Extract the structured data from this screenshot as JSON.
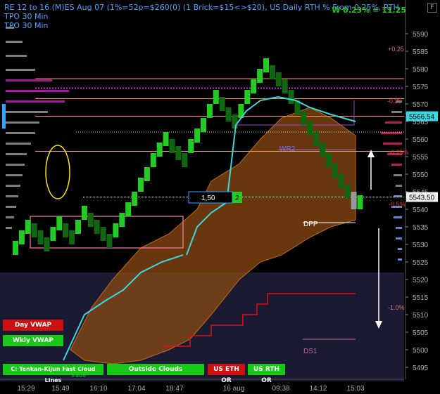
{
  "header": {
    "line1": "RE 12 to 16 (M)ES Aug 07 (1%=52p=$260(0) (1 Brick=$15<>$20), US Daily RTH % From 0.25%, RTH TPO 30 Min",
    "line2": "TPO 30 Min",
    "right_text": "W 0.23% = 11.25",
    "corner_icon": "F"
  },
  "buttons": {
    "day_vwap": "Day VWAP",
    "wkly_vwap": "Wkly VWAP",
    "cloud": "C: Tenkan-Kijun Fast Cloud Lines",
    "outside": "Outside Clouds",
    "us_eth": "US ETH OR",
    "us_rth": "US RTH OR"
  },
  "footer_note": "Trade",
  "price_tags": {
    "current_upper": "5566.54",
    "current_lower": "5543.50",
    "ratio_value": "1,50",
    "ratio_count": "2"
  },
  "levels": {
    "pct_up": "+0.25",
    "pct_minus": "-0.25",
    "pct_minus2": "-0.25%",
    "pct_down": "-0.5%",
    "pct_down_big": "-1.0%",
    "wr2": "WR2",
    "dpp": "DPP",
    "ds1": "DS1"
  },
  "colors": {
    "up_brick": "#22cc22",
    "down_brick": "#116611",
    "cloud": "#8b4a12",
    "cyan_line": "#39d8e0",
    "orange_line": "#ff9a2e",
    "magenta_line": "#d21bd2",
    "red_step": "#e01010"
  },
  "chart_data": {
    "type": "renko",
    "ylim": [
      5493,
      5593
    ],
    "y_ticks": [
      5495,
      5500,
      5505,
      5510,
      5515,
      5520,
      5525,
      5530,
      5535,
      5540,
      5545,
      5550,
      5555,
      5560,
      5565,
      5570,
      5575,
      5580,
      5585,
      5590
    ],
    "x_ticks": [
      "15:29",
      "15:49",
      "16:10",
      "17:04",
      "18:47",
      "16 aug",
      "09:38",
      "14:12",
      "15:03"
    ],
    "bricks": [
      [
        5527,
        5531,
        "up"
      ],
      [
        5530,
        5534,
        "up"
      ],
      [
        5533,
        5537,
        "up"
      ],
      [
        5532,
        5536,
        "down"
      ],
      [
        5530,
        5534,
        "down"
      ],
      [
        5528,
        5532,
        "down"
      ],
      [
        5531,
        5535,
        "up"
      ],
      [
        5534,
        5538,
        "up"
      ],
      [
        5532,
        5536,
        "down"
      ],
      [
        5530,
        5534,
        "down"
      ],
      [
        5533,
        5537,
        "up"
      ],
      [
        5537,
        5541,
        "up"
      ],
      [
        5535,
        5539,
        "down"
      ],
      [
        5533,
        5537,
        "down"
      ],
      [
        5531,
        5535,
        "down"
      ],
      [
        5529,
        5533,
        "down"
      ],
      [
        5532,
        5536,
        "up"
      ],
      [
        5535,
        5539,
        "up"
      ],
      [
        5538,
        5542,
        "up"
      ],
      [
        5541,
        5545,
        "up"
      ],
      [
        5545,
        5549,
        "up"
      ],
      [
        5548,
        5552,
        "up"
      ],
      [
        5552,
        5556,
        "up"
      ],
      [
        5555,
        5559,
        "up"
      ],
      [
        5558,
        5562,
        "up"
      ],
      [
        5556,
        5560,
        "down"
      ],
      [
        5554,
        5558,
        "down"
      ],
      [
        5552,
        5556,
        "down"
      ],
      [
        5556,
        5560,
        "up"
      ],
      [
        5559,
        5563,
        "up"
      ],
      [
        5562,
        5566,
        "up"
      ],
      [
        5566,
        5570,
        "up"
      ],
      [
        5570,
        5574,
        "up"
      ],
      [
        5568,
        5572,
        "down"
      ],
      [
        5565,
        5569,
        "down"
      ],
      [
        5563,
        5567,
        "down"
      ],
      [
        5566,
        5570,
        "up"
      ],
      [
        5570,
        5574,
        "up"
      ],
      [
        5573,
        5577,
        "up"
      ],
      [
        5576,
        5580,
        "up"
      ],
      [
        5579,
        5583,
        "up"
      ],
      [
        5577,
        5581,
        "down"
      ],
      [
        5575,
        5579,
        "down"
      ],
      [
        5573,
        5577,
        "down"
      ],
      [
        5570,
        5574,
        "down"
      ],
      [
        5567,
        5571,
        "down"
      ],
      [
        5564,
        5568,
        "down"
      ],
      [
        5561,
        5565,
        "down"
      ],
      [
        5558,
        5562,
        "down"
      ],
      [
        5555,
        5559,
        "down"
      ],
      [
        5552,
        5556,
        "down"
      ],
      [
        5549,
        5553,
        "down"
      ],
      [
        5546,
        5550,
        "down"
      ],
      [
        5543,
        5547,
        "down"
      ],
      [
        5540,
        5544,
        "down"
      ],
      [
        5540,
        5544,
        "up"
      ]
    ],
    "horizontal_levels": [
      5577.2,
      5571.5,
      5566.5,
      5556.5
    ],
    "magenta_level": 5574.5,
    "white_levels": [
      5562,
      5543.5,
      5536.2
    ]
  }
}
